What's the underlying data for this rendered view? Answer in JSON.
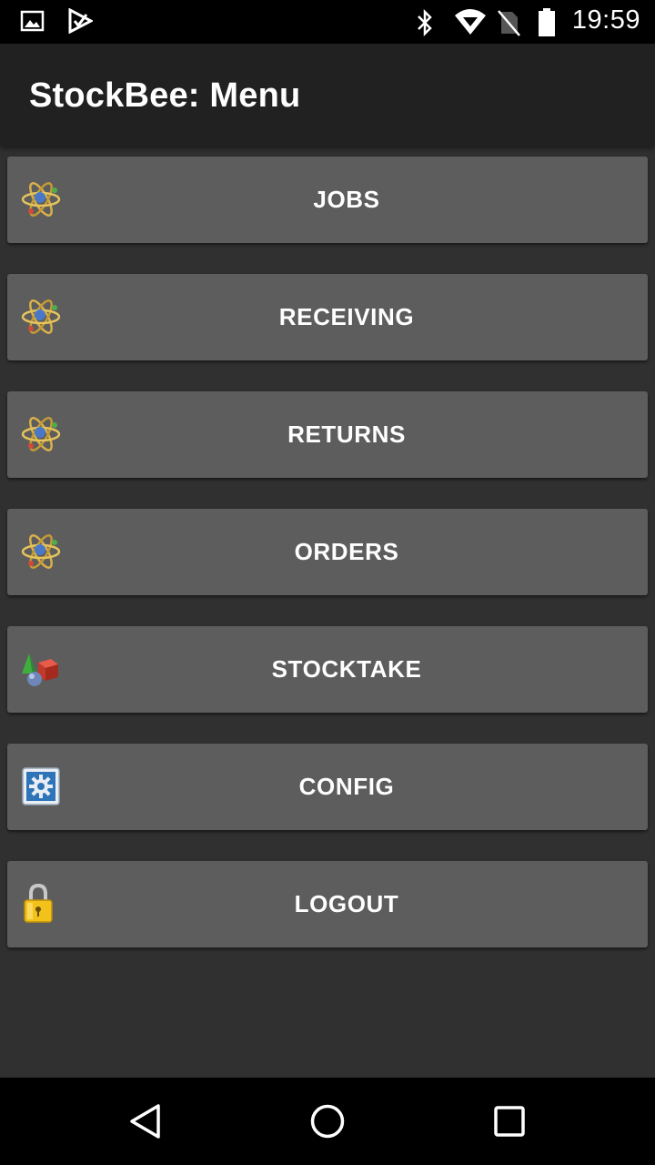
{
  "status_bar": {
    "time": "19:59",
    "left_icons": [
      "image-icon",
      "playstore-icon"
    ],
    "right_icons": [
      "bluetooth-icon",
      "wifi-icon",
      "no-sim-icon",
      "battery-icon"
    ]
  },
  "app_bar": {
    "title": "StockBee: Menu"
  },
  "menu": {
    "items": [
      {
        "label": "JOBS",
        "icon": "atom-icon"
      },
      {
        "label": "RECEIVING",
        "icon": "atom-icon"
      },
      {
        "label": "RETURNS",
        "icon": "atom-icon"
      },
      {
        "label": "ORDERS",
        "icon": "atom-icon"
      },
      {
        "label": "STOCKTAKE",
        "icon": "shapes-icon"
      },
      {
        "label": "CONFIG",
        "icon": "settings-gear-icon"
      },
      {
        "label": "LOGOUT",
        "icon": "padlock-icon"
      }
    ]
  },
  "nav_bar": {
    "buttons": [
      "back-icon",
      "home-icon",
      "recents-icon"
    ]
  },
  "colors": {
    "background": "#303030",
    "app_bar": "#212121",
    "button": "#5d5d5d",
    "text": "#ffffff"
  }
}
